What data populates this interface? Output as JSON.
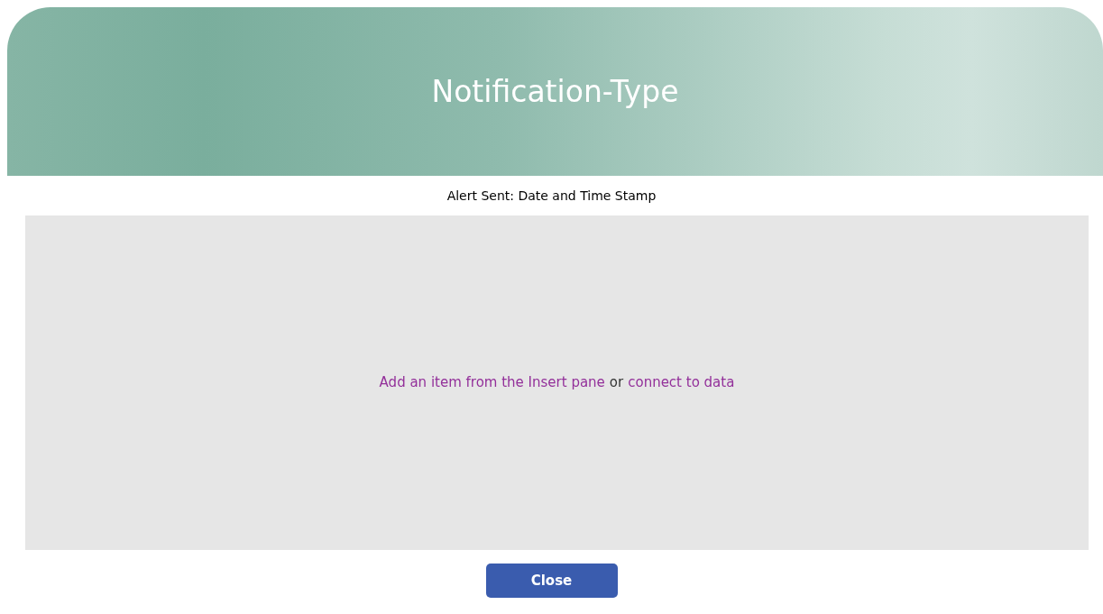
{
  "header": {
    "title": "Notification-Type"
  },
  "subtitle": "Alert Sent: Date and Time Stamp",
  "empty_panel": {
    "parts": [
      {
        "kind": "link",
        "text": "Add an item from the Insert pane"
      },
      {
        "kind": "text",
        "text": "or"
      },
      {
        "kind": "link",
        "text": "connect to data"
      }
    ]
  },
  "buttons": [
    {
      "label": "Close"
    }
  ]
}
